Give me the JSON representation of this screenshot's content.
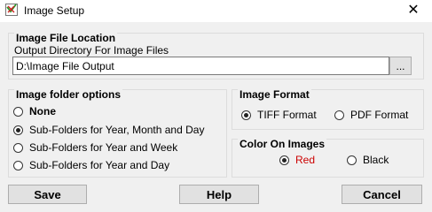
{
  "window": {
    "title": "Image Setup",
    "close_glyph": "✕"
  },
  "file_location": {
    "title": "Image File Location",
    "output_label": "Output Directory For Image Files",
    "output_value": "D:\\Image File Output",
    "browse_label": "..."
  },
  "folder_options": {
    "title": "Image folder options",
    "options": [
      {
        "label": "None",
        "checked": false
      },
      {
        "label": "Sub-Folders for Year, Month and Day",
        "checked": true
      },
      {
        "label": "Sub-Folders for Year and Week",
        "checked": false
      },
      {
        "label": "Sub-Folders for Year and Day",
        "checked": false
      }
    ]
  },
  "image_format": {
    "title": "Image Format",
    "options": [
      {
        "label": "TIFF Format",
        "checked": true
      },
      {
        "label": "PDF Format",
        "checked": false
      }
    ]
  },
  "color": {
    "title": "Color On Images",
    "options": [
      {
        "label": "Red",
        "checked": true,
        "color": "#cc0000"
      },
      {
        "label": "Black",
        "checked": false
      }
    ]
  },
  "buttons": {
    "save": "Save",
    "help": "Help",
    "cancel": "Cancel"
  }
}
